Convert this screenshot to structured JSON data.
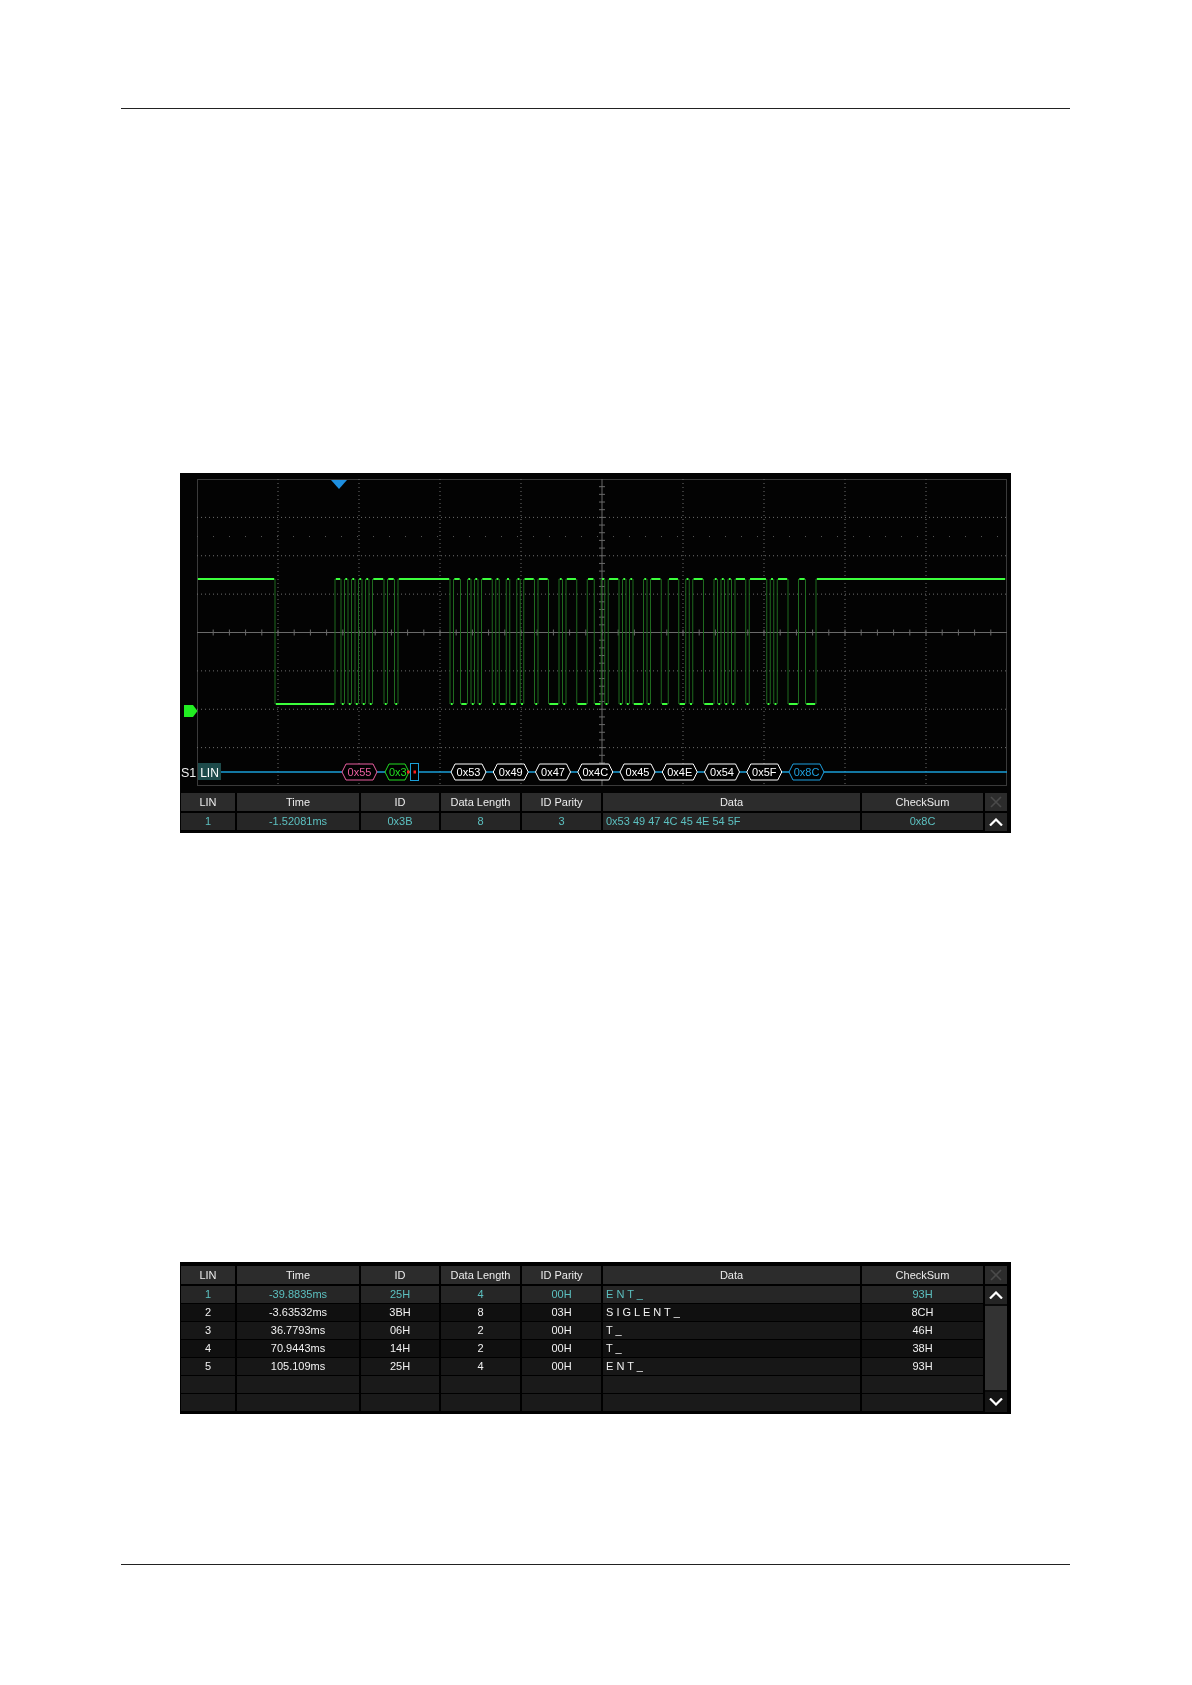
{
  "decode": {
    "bus_label": "S1",
    "protocol": "LIN",
    "frames": [
      {
        "kind": "sync",
        "text": "0x55"
      },
      {
        "kind": "id",
        "text": "0x3"
      },
      {
        "kind": "data",
        "text": "0x53"
      },
      {
        "kind": "data",
        "text": "0x49"
      },
      {
        "kind": "data",
        "text": "0x47"
      },
      {
        "kind": "data",
        "text": "0x4C"
      },
      {
        "kind": "data",
        "text": "0x45"
      },
      {
        "kind": "data",
        "text": "0x4E"
      },
      {
        "kind": "data",
        "text": "0x54"
      },
      {
        "kind": "data",
        "text": "0x5F"
      },
      {
        "kind": "checksum",
        "text": "0x8C"
      }
    ]
  },
  "decode_table": {
    "scrollbar": false,
    "columns": [
      "LIN",
      "Time",
      "ID",
      "Data Length",
      "ID Parity",
      "Data",
      "CheckSum"
    ],
    "rows": [
      {
        "selected": true,
        "cells": [
          "1",
          "-1.52081ms",
          "0x3B",
          "8",
          "3",
          "0x53 49 47 4C 45 4E 54 5F",
          "0x8C"
        ]
      }
    ]
  },
  "list_table": {
    "scrollbar": true,
    "columns": [
      "LIN",
      "Time",
      "ID",
      "Data Length",
      "ID Parity",
      "Data",
      "CheckSum"
    ],
    "rows": [
      {
        "selected": true,
        "cells": [
          "1",
          "-39.8835ms",
          "25H",
          "4",
          "00H",
          "E N T _",
          "93H"
        ]
      },
      {
        "selected": false,
        "cells": [
          "2",
          "-3.63532ms",
          "3BH",
          "8",
          "03H",
          "S I G L E N T _",
          "8CH"
        ]
      },
      {
        "selected": false,
        "cells": [
          "3",
          "36.7793ms",
          "06H",
          "2",
          "00H",
          "T _",
          "46H"
        ]
      },
      {
        "selected": false,
        "cells": [
          "4",
          "70.9443ms",
          "14H",
          "2",
          "00H",
          "T _",
          "38H"
        ]
      },
      {
        "selected": false,
        "cells": [
          "5",
          "105.109ms",
          "25H",
          "4",
          "00H",
          "E N T _",
          "93H"
        ]
      }
    ]
  }
}
